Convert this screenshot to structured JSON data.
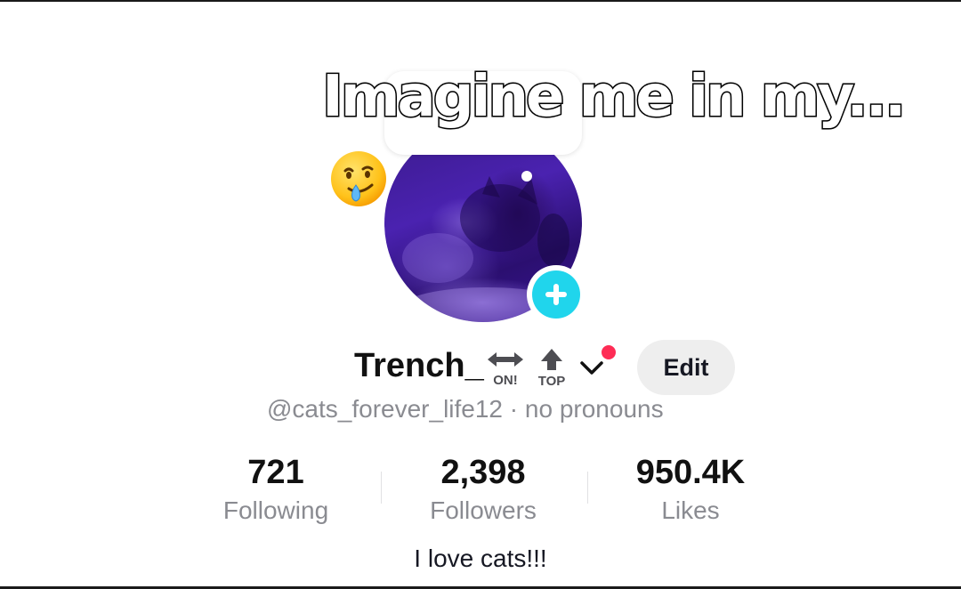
{
  "overlay": {
    "caption": "Imagine me in my..."
  },
  "profile": {
    "username": "Trench_",
    "badges": [
      {
        "icon": "left-right-arrow-icon",
        "text": "ON!"
      },
      {
        "icon": "up-arrow-icon",
        "text": "TOP"
      }
    ],
    "handle": "@cats_forever_life12",
    "pronouns": "no pronouns",
    "separator": "·",
    "edit_label": "Edit",
    "bio": "I love cats!!!"
  },
  "stats": [
    {
      "value": "721",
      "label": "Following"
    },
    {
      "value": "2,398",
      "label": "Followers"
    },
    {
      "value": "950.4K",
      "label": "Likes"
    }
  ],
  "colors": {
    "accent_cyan": "#20d5ec",
    "notification_red": "#fe2c55",
    "muted_text": "#8a8b91",
    "avatar_tint": "#3b1a8c"
  }
}
